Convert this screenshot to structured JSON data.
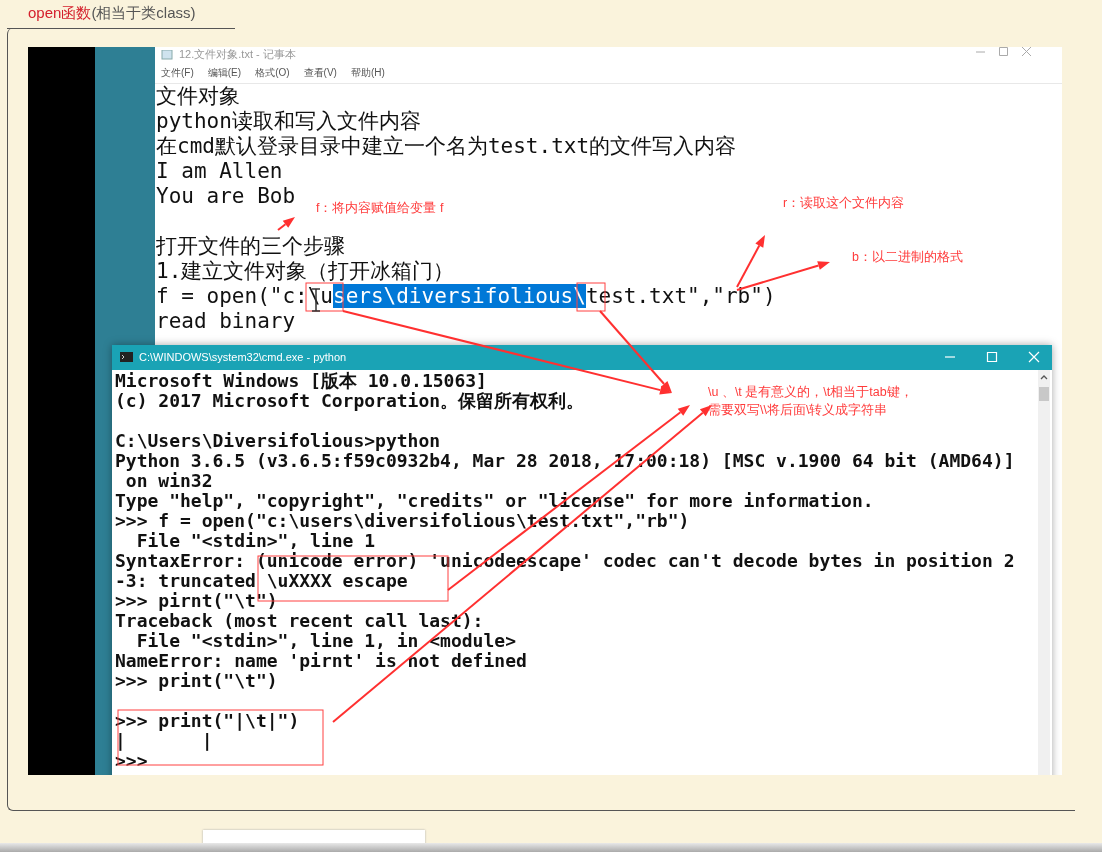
{
  "note": {
    "title_highlight": "open函数",
    "title_rest": "(相当于类class)"
  },
  "notepad": {
    "title": "12.文件对象.txt - 记事本",
    "menu": [
      "文件(F)",
      "编辑(E)",
      "格式(O)",
      "查看(V)",
      "帮助(H)"
    ],
    "lines": [
      {
        "kind": "text",
        "text": "文件对象"
      },
      {
        "kind": "text",
        "text": "python读取和写入文件内容"
      },
      {
        "kind": "text",
        "text": "在cmd默认登录目录中建立一个名为test.txt的文件写入内容"
      },
      {
        "kind": "text",
        "text": "I am Allen"
      },
      {
        "kind": "text",
        "text": "You are Bob"
      },
      {
        "kind": "blank"
      },
      {
        "kind": "text",
        "text": "打开文件的三个步骤"
      },
      {
        "kind": "text",
        "text": "1.建立文件对象（打开冰箱门）"
      },
      {
        "kind": "selection",
        "before": "f = open(\"c:\\u",
        "selected": "sers\\diversifolious\\",
        "after": "test.txt\",\"rb\")"
      },
      {
        "kind": "text",
        "text": "read binary"
      }
    ]
  },
  "cmd": {
    "title": "C:\\WINDOWS\\system32\\cmd.exe - python",
    "lines": [
      {
        "kind": "text",
        "text": "Microsoft Windows [版本 10.0.15063]"
      },
      {
        "kind": "text",
        "text": "(c) 2017 Microsoft Corporation。保留所有权利。"
      },
      {
        "kind": "blank"
      },
      {
        "kind": "text",
        "text": "C:\\Users\\Diversifolious>python"
      },
      {
        "kind": "text",
        "text": "Python 3.6.5 (v3.6.5:f59c0932b4, Mar 28 2018, 17:00:18) [MSC v.1900 64 bit (AMD64)]"
      },
      {
        "kind": "text",
        "text": " on win32"
      },
      {
        "kind": "text",
        "text": "Type \"help\", \"copyright\", \"credits\" or \"license\" for more information."
      },
      {
        "kind": "text",
        "text": ">>> f = open(\"c:\\users\\diversifolious\\test.txt\",\"rb\")"
      },
      {
        "kind": "text",
        "text": "  File \"<stdin>\", line 1"
      },
      {
        "kind": "text",
        "text": "SyntaxError: (unicode error) 'unicodeescape' codec can't decode bytes in position 2"
      },
      {
        "kind": "text",
        "text": "-3: truncated \\uXXXX escape"
      },
      {
        "kind": "text",
        "text": ">>> pirnt(\"\\t\")"
      },
      {
        "kind": "text",
        "text": "Traceback (most recent call last):"
      },
      {
        "kind": "text",
        "text": "  File \"<stdin>\", line 1, in <module>"
      },
      {
        "kind": "text",
        "text": "NameError: name 'pirnt' is not defined"
      },
      {
        "kind": "text",
        "text": ">>> print(\"\\t\")"
      },
      {
        "kind": "blank"
      },
      {
        "kind": "text",
        "text": ">>> print(\"|\\t|\")"
      },
      {
        "kind": "text",
        "text": "|       |"
      },
      {
        "kind": "text",
        "text": ">>>"
      }
    ]
  },
  "annotations": [
    {
      "lines": [
        "f：将内容赋值给变量 f"
      ]
    },
    {
      "lines": [
        "r：读取这个文件内容"
      ]
    },
    {
      "lines": [
        "b：以二进制的格式"
      ]
    },
    {
      "lines": [
        "\\u 、\\t 是有意义的，\\t相当于tab键，",
        "需要双写\\\\将后面\\转义成字符串"
      ]
    }
  ]
}
